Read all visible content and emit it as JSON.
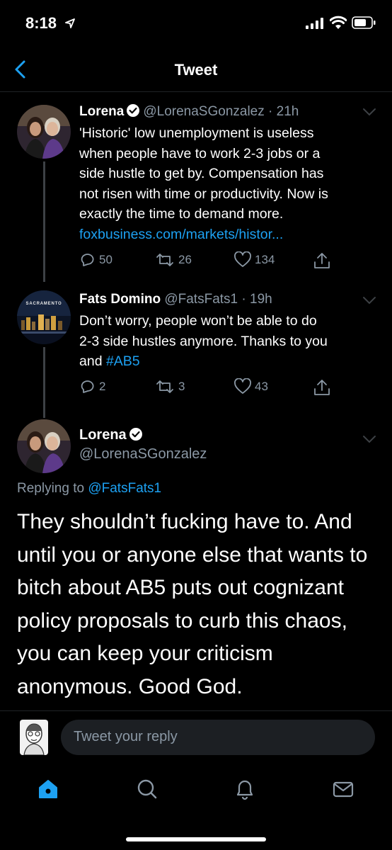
{
  "status": {
    "time": "8:18"
  },
  "nav": {
    "title": "Tweet"
  },
  "tweets": [
    {
      "name": "Lorena",
      "handle": "@LorenaSGonzalez",
      "time": "21h",
      "lines": [
        "'Historic' low unemployment is useless",
        "when people have to work 2-3 jobs or a",
        "side hustle to get by. Compensation has",
        "not risen with time or productivity. Now is",
        "exactly the time to demand more."
      ],
      "link": "foxbusiness.com/markets/histor...",
      "replies": "50",
      "retweets": "26",
      "likes": "134"
    },
    {
      "name": "Fats Domino",
      "handle": "@FatsFats1",
      "time": "19h",
      "lines": [
        "Don’t worry, people won’t be able to do",
        "2-3 side hustles anymore. Thanks to you"
      ],
      "last_line_prefix": "and ",
      "hashtag": "#AB5",
      "avatar_text": "SACRAMENTO",
      "replies": "2",
      "retweets": "3",
      "likes": "43"
    }
  ],
  "main_tweet": {
    "name": "Lorena",
    "handle": "@LorenaSGonzalez",
    "replying_prefix": "Replying to ",
    "replying_handle": "@FatsFats1",
    "lines": [
      "They shouldn’t fucking have to. And",
      "until you or anyone else that wants to",
      "bitch about AB5 puts out cognizant",
      "policy proposals to curb this chaos,",
      "you can keep your criticism",
      "anonymous. Good God."
    ]
  },
  "reply_box": {
    "placeholder": "Tweet your reply"
  },
  "tabs": [
    "home-icon",
    "search-icon",
    "notifications-icon",
    "messages-icon"
  ],
  "colors": {
    "accent": "#1da1f2",
    "background": "#000000",
    "secondary_text": "#8b98a5"
  }
}
